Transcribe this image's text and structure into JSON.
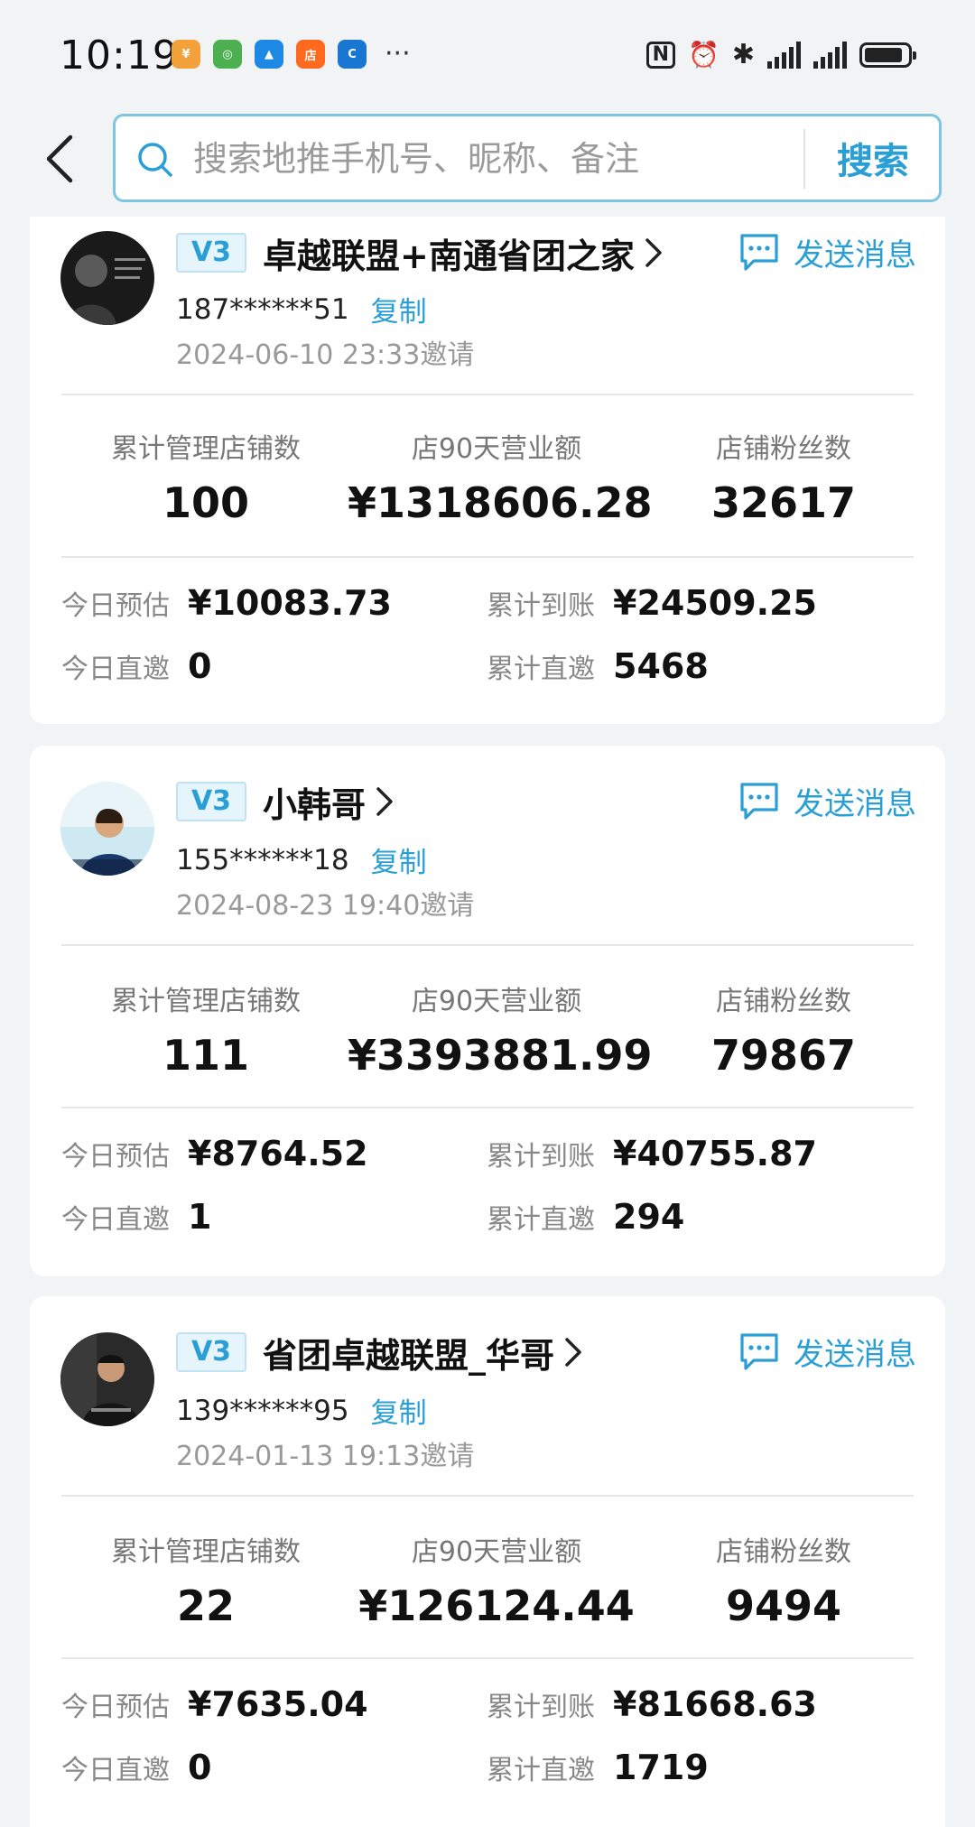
{
  "status_bar": {
    "time": "10:19",
    "apps": [
      {
        "icon": "app-icon-orange",
        "color": "#f3a23b",
        "text": "¥"
      },
      {
        "icon": "app-icon-colorful",
        "color": "#4caf50",
        "text": "◎"
      },
      {
        "icon": "app-icon-blue-bird",
        "color": "#1e88e5",
        "text": "▲"
      },
      {
        "icon": "app-icon-orange-square",
        "color": "#ff6a1f",
        "text": "店"
      },
      {
        "icon": "app-icon-blue-c",
        "color": "#1976d2",
        "text": "C"
      }
    ],
    "more": "···",
    "nfc": "N",
    "alarm": "⏰",
    "bluetooth": "✱",
    "battery_level": 0.9
  },
  "search": {
    "placeholder": "搜索地推手机号、昵称、备注",
    "button_label": "搜索"
  },
  "common": {
    "send_message_label": "发送消息",
    "copy_label": "复制",
    "stat_labels": [
      "累计管理店铺数",
      "店90天营业额",
      "店铺粉丝数"
    ],
    "today_estimate_label": "今日预估",
    "total_received_label": "累计到账",
    "today_invite_label": "今日直邀",
    "total_invite_label": "累计直邀"
  },
  "cards": [
    {
      "level": "V3",
      "name": "卓越联盟+南通省团之家",
      "phone": "187******51",
      "invite_time": "2024-06-10 23:33邀请",
      "stores": "100",
      "revenue_90d": "¥1318606.28",
      "fans": "32617",
      "today_estimate": "¥10083.73",
      "total_received": "¥24509.25",
      "today_invite": "0",
      "total_invite": "5468"
    },
    {
      "level": "V3",
      "name": "小韩哥",
      "phone": "155******18",
      "invite_time": "2024-08-23 19:40邀请",
      "stores": "111",
      "revenue_90d": "¥3393881.99",
      "fans": "79867",
      "today_estimate": "¥8764.52",
      "total_received": "¥40755.87",
      "today_invite": "1",
      "total_invite": "294"
    },
    {
      "level": "V3",
      "name": "省团卓越联盟_华哥",
      "phone": "139******95",
      "invite_time": "2024-01-13 19:13邀请",
      "stores": "22",
      "revenue_90d": "¥126124.44",
      "fans": "9494",
      "today_estimate": "¥7635.04",
      "total_received": "¥81668.63",
      "today_invite": "0",
      "total_invite": "1719"
    }
  ]
}
